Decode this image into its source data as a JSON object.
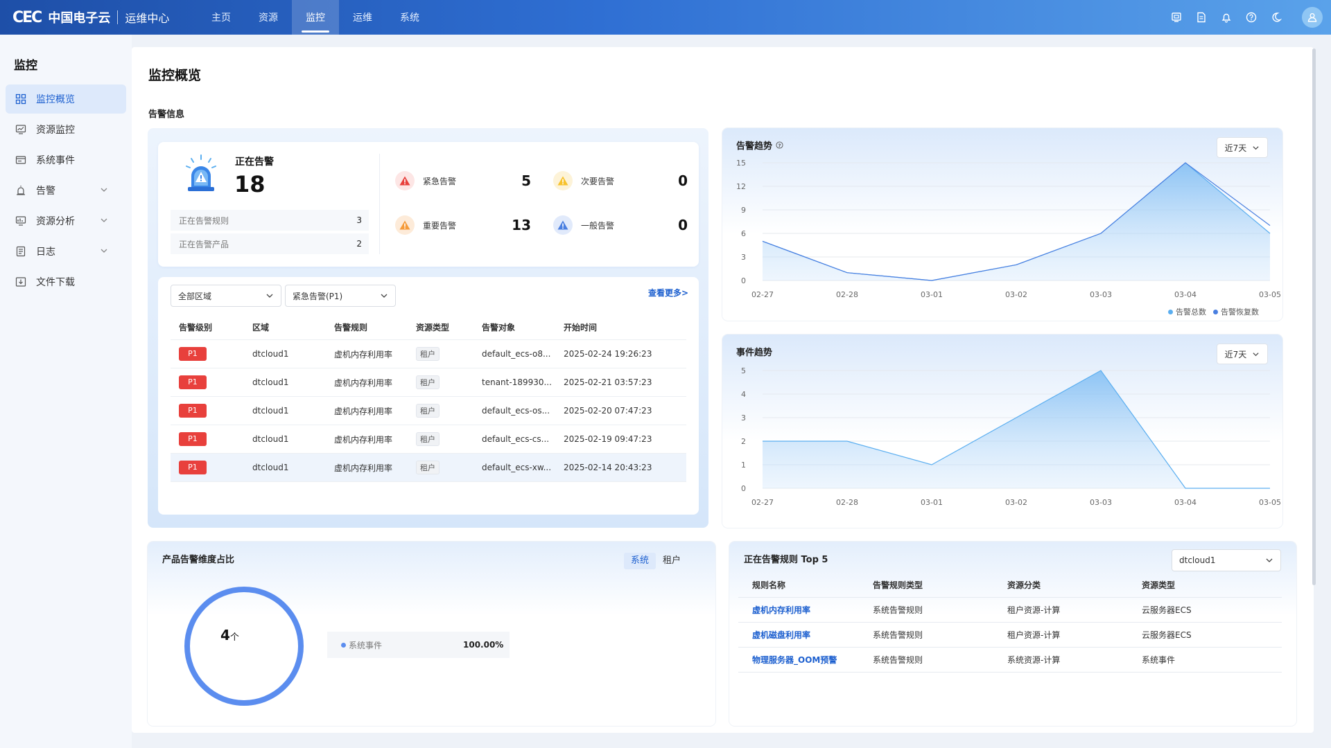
{
  "header": {
    "logo_mark": "CEC",
    "brand": "中国电子云",
    "product": "运维中心",
    "nav": [
      "主页",
      "资源",
      "监控",
      "运维",
      "系统"
    ],
    "active_nav": "监控",
    "icons": [
      "screen-icon",
      "document-icon",
      "bell-icon",
      "help-icon",
      "moon-icon",
      "user-icon"
    ]
  },
  "sidebar": {
    "title": "监控",
    "items": [
      {
        "label": "监控概览",
        "icon": "grid-icon",
        "active": true
      },
      {
        "label": "资源监控",
        "icon": "monitor-icon"
      },
      {
        "label": "系统事件",
        "icon": "event-icon"
      },
      {
        "label": "告警",
        "icon": "alarm-icon",
        "expandable": true
      },
      {
        "label": "资源分析",
        "icon": "analysis-icon",
        "expandable": true
      },
      {
        "label": "日志",
        "icon": "log-icon",
        "expandable": true
      },
      {
        "label": "文件下载",
        "icon": "download-icon"
      }
    ]
  },
  "page": {
    "title": "监控概览",
    "section_alarm": "告警信息"
  },
  "alarm_summary": {
    "label": "正在告警",
    "value": "18",
    "rules_label": "正在告警规则",
    "rules_value": "3",
    "products_label": "正在告警产品",
    "products_value": "2",
    "severities": [
      {
        "label": "紧急告警",
        "value": "5",
        "color": "#e8403c"
      },
      {
        "label": "次要告警",
        "value": "0",
        "color": "#f7c22d"
      },
      {
        "label": "重要告警",
        "value": "13",
        "color": "#f59b3a"
      },
      {
        "label": "一般告警",
        "value": "0",
        "color": "#4a7fe0"
      }
    ]
  },
  "alarm_table": {
    "filter_region": "全部区域",
    "filter_level": "紧急告警(P1)",
    "more": "查看更多>",
    "headers": [
      "告警级别",
      "区域",
      "告警规则",
      "资源类型",
      "告警对象",
      "开始时间"
    ],
    "rows": [
      {
        "level": "P1",
        "region": "dtcloud1",
        "rule": "虚机内存利用率",
        "type": "租户",
        "target": "default_ecs-o8...",
        "time": "2025-02-24 19:26:23"
      },
      {
        "level": "P1",
        "region": "dtcloud1",
        "rule": "虚机内存利用率",
        "type": "租户",
        "target": "tenant-189930...",
        "time": "2025-02-21 03:57:23"
      },
      {
        "level": "P1",
        "region": "dtcloud1",
        "rule": "虚机内存利用率",
        "type": "租户",
        "target": "default_ecs-os...",
        "time": "2025-02-20 07:47:23"
      },
      {
        "level": "P1",
        "region": "dtcloud1",
        "rule": "虚机内存利用率",
        "type": "租户",
        "target": "default_ecs-cs...",
        "time": "2025-02-19 09:47:23"
      },
      {
        "level": "P1",
        "region": "dtcloud1",
        "rule": "虚机内存利用率",
        "type": "租户",
        "target": "default_ecs-xw...",
        "time": "2025-02-14 20:43:23"
      }
    ]
  },
  "alarm_trend": {
    "title": "告警趋势",
    "range": "近7天",
    "legend": [
      "告警总数",
      "告警恢复数"
    ]
  },
  "event_trend": {
    "title": "事件趋势",
    "range": "近7天"
  },
  "chart_data": [
    {
      "type": "area",
      "title": "告警趋势",
      "x": [
        "02-27",
        "02-28",
        "03-01",
        "03-02",
        "03-03",
        "03-04",
        "03-05"
      ],
      "ylim": [
        0,
        15
      ],
      "yticks": [
        0,
        3,
        6,
        9,
        12,
        15
      ],
      "grid": true,
      "legend": "bottom-right",
      "series": [
        {
          "name": "告警总数",
          "color": "#5aaef0",
          "values": [
            5,
            1,
            0,
            2,
            6,
            15,
            6
          ]
        },
        {
          "name": "告警恢复数",
          "color": "#4a7fe0",
          "values": [
            5,
            1,
            0,
            2,
            6,
            15,
            7
          ]
        }
      ]
    },
    {
      "type": "area",
      "title": "事件趋势",
      "x": [
        "02-27",
        "02-28",
        "03-01",
        "03-02",
        "03-03",
        "03-04",
        "03-05"
      ],
      "ylim": [
        0,
        5
      ],
      "yticks": [
        0,
        1,
        2,
        3,
        4,
        5
      ],
      "grid": true,
      "series": [
        {
          "color": "#5aaef0",
          "values": [
            2,
            2,
            1,
            3,
            5,
            0,
            0
          ]
        }
      ]
    }
  ],
  "product_ratio": {
    "title": "产品告警维度占比",
    "tabs": [
      "系统",
      "租户"
    ],
    "active_tab": "系统",
    "total": "4",
    "unit": "个",
    "items": [
      {
        "name": "系统事件",
        "pct": "100.00%",
        "color": "#5b8def"
      }
    ]
  },
  "top_rules": {
    "title": "正在告警规则 Top 5",
    "region": "dtcloud1",
    "headers": [
      "规则名称",
      "告警规则类型",
      "资源分类",
      "资源类型"
    ],
    "rows": [
      {
        "name": "虚机内存利用率",
        "rule_type": "系统告警规则",
        "category": "租户资源-计算",
        "res_type": "云服务器ECS"
      },
      {
        "name": "虚机磁盘利用率",
        "rule_type": "系统告警规则",
        "category": "租户资源-计算",
        "res_type": "云服务器ECS"
      },
      {
        "name": "物理服务器_OOM预警",
        "rule_type": "系统告警规则",
        "category": "系统资源-计算",
        "res_type": "系统事件"
      }
    ]
  }
}
